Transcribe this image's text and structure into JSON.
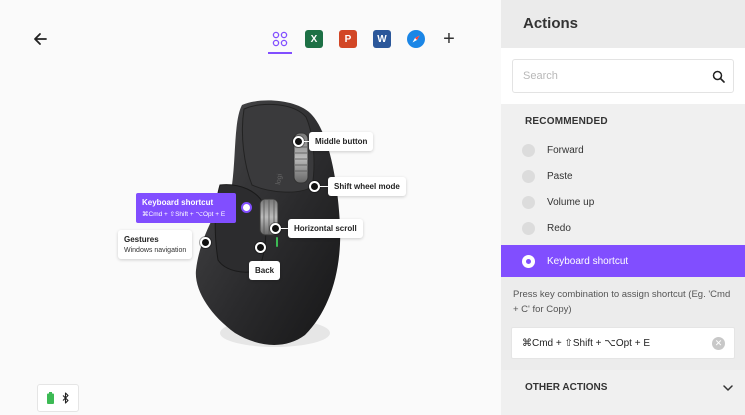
{
  "window": {
    "traffic_lights": [
      "close",
      "minimize",
      "zoom"
    ]
  },
  "main": {
    "back_icon": "arrow-left-icon",
    "app_tabs": [
      {
        "name": "all-applications",
        "icon": "grid-icon",
        "active": true
      },
      {
        "name": "excel",
        "icon": "excel-icon",
        "letter": "X",
        "color": "#1d7045"
      },
      {
        "name": "powerpoint",
        "icon": "powerpoint-icon",
        "letter": "P",
        "color": "#d24625"
      },
      {
        "name": "word",
        "icon": "word-icon",
        "letter": "W",
        "color": "#2b579a"
      },
      {
        "name": "safari",
        "icon": "safari-icon",
        "color": "#1b86e6"
      }
    ],
    "add_app_icon": "plus-icon",
    "callouts": {
      "middle_button": "Middle button",
      "shift_wheel_mode": "Shift wheel mode",
      "keyboard_shortcut_title": "Keyboard shortcut",
      "keyboard_shortcut_value": "⌘Cmd + ⇧Shift + ⌥Opt + E",
      "horizontal_scroll": "Horizontal scroll",
      "gestures_title": "Gestures",
      "gestures_value": "Windows navigation",
      "back": "Back"
    },
    "status": {
      "battery_icon": "battery-icon",
      "connection_icon": "bluetooth-icon"
    }
  },
  "panel": {
    "title": "Actions",
    "search_placeholder": "Search",
    "recommended_header": "RECOMMENDED",
    "actions": [
      {
        "label": "Forward"
      },
      {
        "label": "Paste"
      },
      {
        "label": "Volume up"
      },
      {
        "label": "Redo"
      }
    ],
    "selected_action": {
      "label": "Keyboard shortcut",
      "hint": "Press key combination to assign shortcut (Eg. 'Cmd + C' for Copy)",
      "shortcut_value": "⌘Cmd + ⇧Shift + ⌥Opt + E"
    },
    "other_actions_header": "OTHER ACTIONS"
  },
  "colors": {
    "accent": "#814eff",
    "panel_bg": "#f0f0f0",
    "battery": "#3cba54"
  }
}
